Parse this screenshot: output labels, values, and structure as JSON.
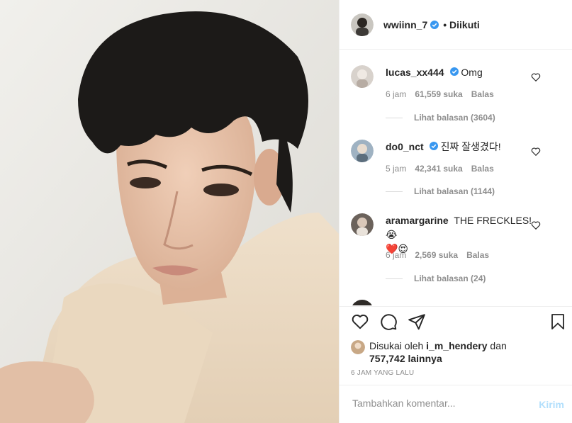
{
  "post": {
    "author": "wwiinn_7",
    "follow_status": "• Diikuti",
    "verified": true
  },
  "comments": [
    {
      "user": "lucas_xx444",
      "verified": true,
      "text": "Omg",
      "time": "6 jam",
      "likes": "61,559 suka",
      "reply": "Balas",
      "view_replies": "Lihat balasan (3604)"
    },
    {
      "user": "do0_nct",
      "verified": true,
      "text": "진짜 잘생겼다!",
      "time": "5 jam",
      "likes": "42,341 suka",
      "reply": "Balas",
      "view_replies": "Lihat balasan (1144)"
    },
    {
      "user": "aramargarine",
      "verified": false,
      "text": "THE FRECKLES! 😭",
      "text_line2": "❤️😍",
      "time": "6 jam",
      "likes": "2,569 suka",
      "reply": "Balas",
      "view_replies": "Lihat balasan (24)"
    }
  ],
  "likes": {
    "prefix": "Disukai oleh",
    "user": "i_m_hendery",
    "conj": "dan",
    "count": "757,742 lainnya"
  },
  "timestamp": "6 JAM YANG LALU",
  "add_comment": {
    "placeholder": "Tambahkan komentar...",
    "post_label": "Kirim"
  },
  "icons": [
    "heart-icon",
    "comment-icon",
    "share-icon",
    "bookmark-icon"
  ],
  "colors": {
    "verified": "#3897f0",
    "muted": "#8e8e8e",
    "post_disabled": "#b2dffc"
  }
}
